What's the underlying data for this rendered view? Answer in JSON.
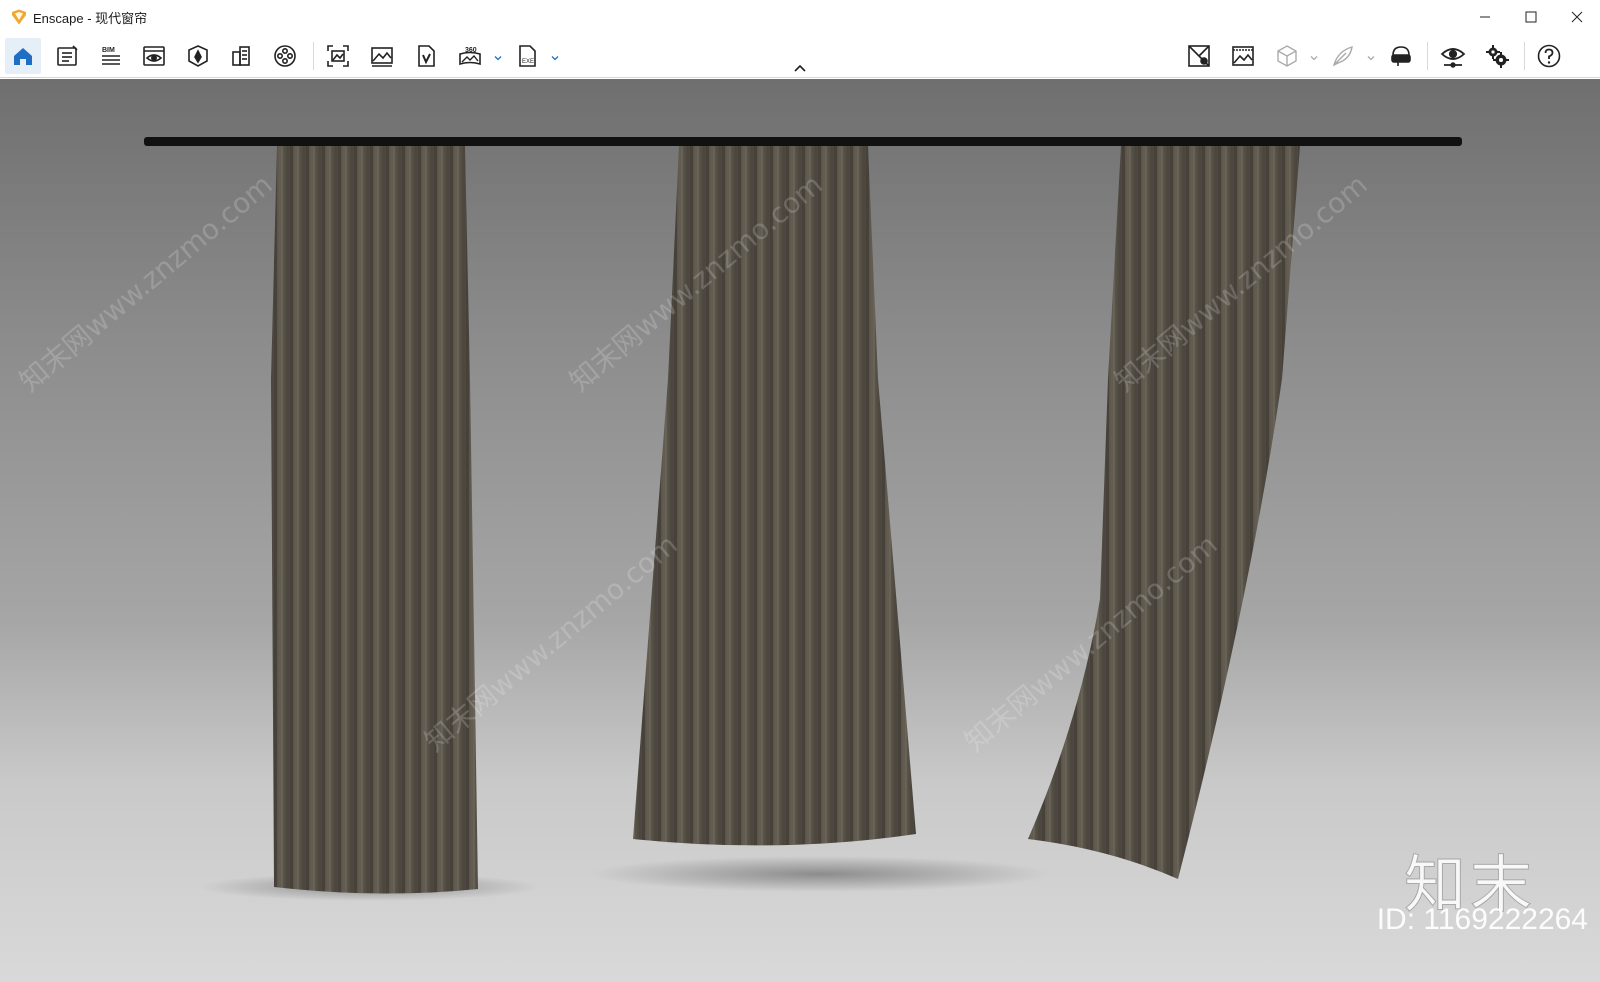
{
  "window": {
    "app_name": "Enscape",
    "title": "Enscape - 现代窗帘",
    "logo_color": "#f0a830"
  },
  "toolbar": {
    "left_buttons": [
      {
        "name": "home-icon",
        "active": true
      },
      {
        "name": "views-manager-icon"
      },
      {
        "name": "bim-icon"
      },
      {
        "name": "visual-settings-icon"
      },
      {
        "name": "asset-library-icon"
      },
      {
        "name": "building-icon"
      },
      {
        "name": "video-reel-icon"
      },
      {
        "name": "screenshot-icon"
      },
      {
        "name": "batch-render-icon"
      },
      {
        "name": "standalone-export-icon"
      },
      {
        "name": "panorama-360-icon"
      },
      {
        "name": "exe-export-icon"
      }
    ],
    "right_buttons": [
      {
        "name": "capture-location-icon"
      },
      {
        "name": "gallery-icon"
      },
      {
        "name": "cube-icon"
      },
      {
        "name": "feather-icon"
      },
      {
        "name": "vr-headset-icon"
      },
      {
        "name": "eye-settings-icon"
      },
      {
        "name": "gears-icon"
      },
      {
        "name": "help-icon"
      }
    ],
    "bim_label": "BIM",
    "pano_label": "360",
    "exe_label": "EXE",
    "accent_color": "#1e6fc4"
  },
  "viewport": {
    "rod_color": "#111111",
    "curtain_color": "#5d574d",
    "watermark_brand": "知末",
    "watermark_id": "ID: 1169222264",
    "diagonal_watermark": "知末网www.znzmo.com"
  }
}
